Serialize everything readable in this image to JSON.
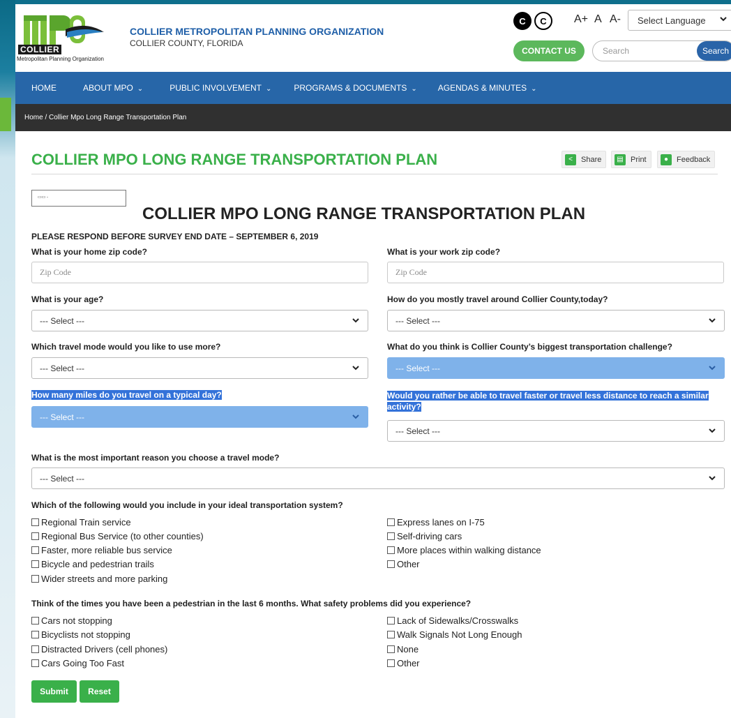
{
  "header": {
    "logo_text": "mpo",
    "logo_collier": "COLLIER",
    "logo_sub": "Metropolitan Planning Organization",
    "org_name": "COLLIER METROPOLITAN PLANNING ORGANIZATION",
    "org_county": "COLLIER COUNTY, FLORIDA",
    "contrast_dark": "C",
    "contrast_light": "C",
    "font_larger": "A+",
    "font_normal": "A",
    "font_smaller": "A-",
    "language": "Select Language",
    "contact": "CONTACT US",
    "search_placeholder": "Search",
    "search_button": "Search"
  },
  "nav": [
    {
      "label": "HOME",
      "dropdown": false
    },
    {
      "label": "ABOUT MPO",
      "dropdown": true
    },
    {
      "label": "PUBLIC INVOLVEMENT",
      "dropdown": true
    },
    {
      "label": "PROGRAMS & DOCUMENTS",
      "dropdown": true
    },
    {
      "label": "AGENDAS & MINUTES",
      "dropdown": true
    }
  ],
  "breadcrumb": "Home / Collier Mpo Long Range Transportation Plan",
  "page_title": "COLLIER MPO LONG RANGE TRANSPORTATION PLAN",
  "tools": {
    "share": "Share",
    "print": "Print",
    "feedback": "Feedback"
  },
  "survey": {
    "title": "COLLIER MPO LONG RANGE TRANSPORTATION PLAN",
    "notice": "PLEASE RESPOND BEFORE SURVEY END DATE – SEPTEMBER 6, 2019",
    "home_zip_label": "What is your home zip code?",
    "home_zip_placeholder": "Zip Code",
    "work_zip_label": "What is your work zip code?",
    "work_zip_placeholder": "Zip Code",
    "age_label": "What is your age?",
    "travel_today_label": "How do you mostly travel around Collier County,today?",
    "mode_more_label": "Which travel mode would you like to use more?",
    "challenge_label": "What do you think is Collier County’s biggest transportation challenge?",
    "miles_label": "How many miles do you travel on a typical day?",
    "faster_label": "Would you rather be able to travel faster or travel less distance to reach a similar activity?",
    "reason_label": "What is the most important reason you choose a travel mode?",
    "select_default": "--- Select ---",
    "ideal_label": "Which of the following would you include in your ideal transportation system?",
    "ideal_left": [
      "Regional Train service",
      "Regional Bus Service (to other counties)",
      "Faster, more reliable bus service",
      "Bicycle and pedestrian trails",
      "Wider streets and more parking"
    ],
    "ideal_right": [
      "Express lanes on I-75",
      "Self-driving cars",
      "More places within walking distance",
      "Other"
    ],
    "ped_label": "Think of the times you have been a pedestrian in the last 6 months. What safety problems did you experience?",
    "ped_left": [
      "Cars not stopping",
      "Bicyclists not stopping",
      "Distracted Drivers (cell phones)",
      "Cars Going Too Fast"
    ],
    "ped_right": [
      "Lack of Sidewalks/Crosswalks",
      "Walk Signals Not Long Enough",
      "None",
      "Other"
    ],
    "submit": "Submit",
    "reset": "Reset"
  }
}
